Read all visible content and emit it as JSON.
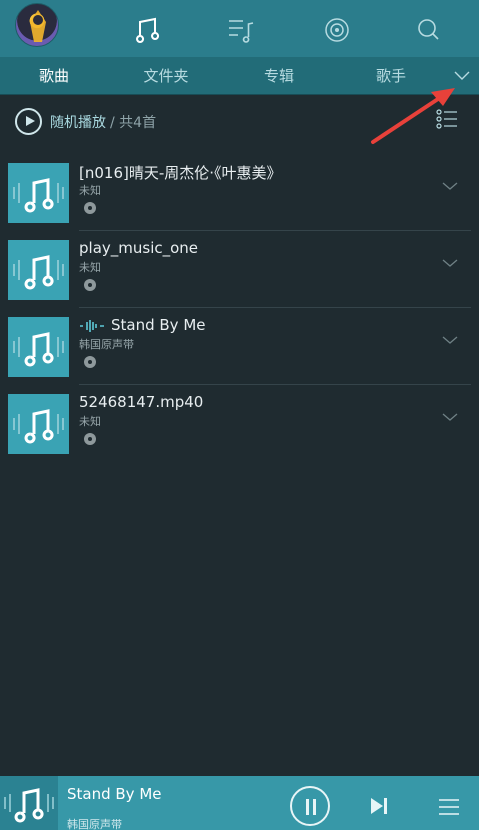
{
  "top": {
    "icons": [
      "music-note-icon",
      "playlist-icon",
      "radio-icon",
      "search-icon"
    ]
  },
  "tabs": [
    {
      "label": "歌曲",
      "active": true
    },
    {
      "label": "文件夹",
      "active": false
    },
    {
      "label": "专辑",
      "active": false
    },
    {
      "label": "歌手",
      "active": false
    }
  ],
  "shuffle": {
    "label": "随机播放",
    "count": "/ 共4首"
  },
  "songs": [
    {
      "title": "[n016]晴天-周杰伦·《叶惠美》",
      "artist": "未知"
    },
    {
      "title": "play_music_one",
      "artist": "未知"
    },
    {
      "title": "Stand By Me",
      "artist": "韩国原声带",
      "playing": true
    },
    {
      "title": "52468147.mp40",
      "artist": "未知"
    }
  ],
  "player": {
    "title": "Stand By Me",
    "artist": "韩国原声带"
  },
  "colors": {
    "accent": "#2b7d8c",
    "background": "#1f2b30",
    "annotation": "#e8413a"
  }
}
